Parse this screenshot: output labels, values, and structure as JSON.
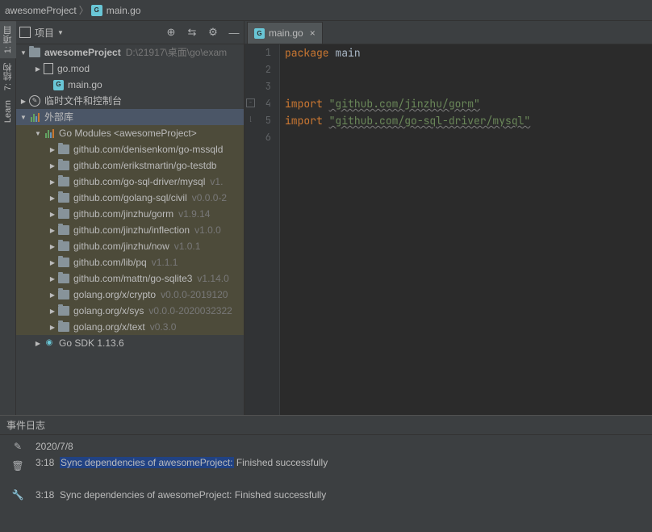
{
  "breadcrumb": {
    "project": "awesomeProject",
    "file": "main.go"
  },
  "panel": {
    "title": "项目",
    "toolbar_icons": [
      "target-icon",
      "collapse-icon",
      "gear-icon",
      "minimize-icon"
    ]
  },
  "tree": {
    "root": {
      "name": "awesomeProject",
      "path": "D:\\21917\\桌面\\go\\exam"
    },
    "gomod": "go.mod",
    "maingo": "main.go",
    "scratch": "临时文件和控制台",
    "external": "外部库",
    "gomodules": "Go Modules <awesomeProject>",
    "deps": [
      {
        "name": "github.com/denisenkom/go-mssqld",
        "ver": ""
      },
      {
        "name": "github.com/erikstmartin/go-testdb",
        "ver": ""
      },
      {
        "name": "github.com/go-sql-driver/mysql",
        "ver": "v1."
      },
      {
        "name": "github.com/golang-sql/civil",
        "ver": "v0.0.0-2"
      },
      {
        "name": "github.com/jinzhu/gorm",
        "ver": "v1.9.14"
      },
      {
        "name": "github.com/jinzhu/inflection",
        "ver": "v1.0.0"
      },
      {
        "name": "github.com/jinzhu/now",
        "ver": "v1.0.1"
      },
      {
        "name": "github.com/lib/pq",
        "ver": "v1.1.1"
      },
      {
        "name": "github.com/mattn/go-sqlite3",
        "ver": "v1.14.0"
      },
      {
        "name": "golang.org/x/crypto",
        "ver": "v0.0.0-2019120"
      },
      {
        "name": "golang.org/x/sys",
        "ver": "v0.0.0-2020032322"
      },
      {
        "name": "golang.org/x/text",
        "ver": "v0.3.0"
      }
    ],
    "sdk": "Go SDK 1.13.6"
  },
  "editor": {
    "tab": "main.go",
    "code": {
      "l1_kw": "package",
      "l1_id": "main",
      "l4_kw": "import",
      "l4_str": "\"github.com/jinzhu/gorm\"",
      "l5_kw": "import",
      "l5_str": "\"github.com/go-sql-driver/mysql\""
    }
  },
  "gutter": {
    "project_tab": "1: 项目",
    "structure_tab": "7: 结构",
    "learn_tab": "Learn"
  },
  "eventlog": {
    "title": "事件日志",
    "date": "2020/7/8",
    "entries": [
      {
        "time": "3:18",
        "link": "Sync dependencies of awesomeProject:",
        "rest": "Finished successfully"
      },
      {
        "time": "3:18",
        "link": "Sync dependencies of awesomeProject:",
        "rest": "Finished successfully"
      }
    ]
  }
}
